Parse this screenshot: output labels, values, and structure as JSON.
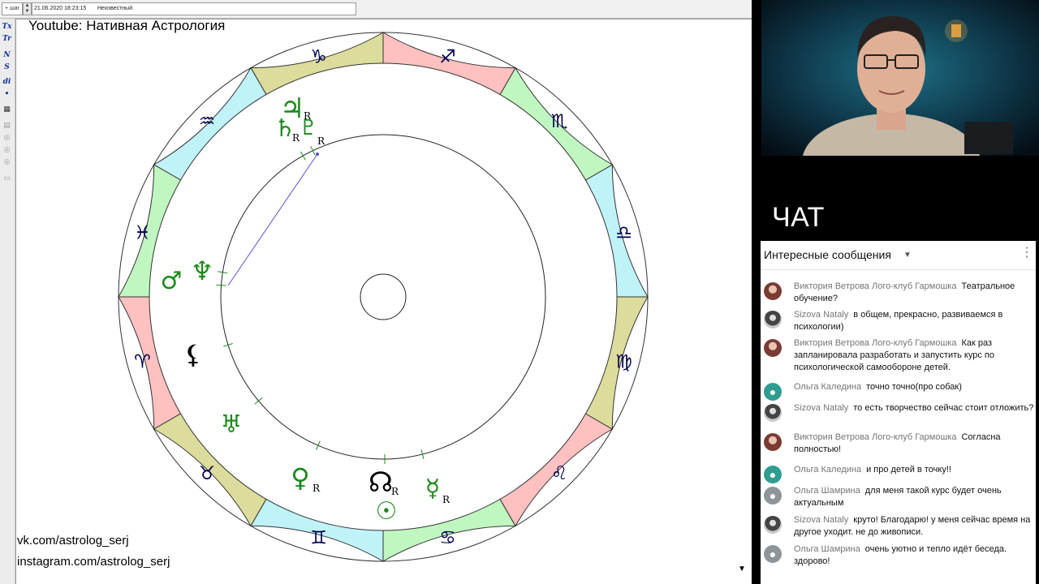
{
  "toolbar_top": {
    "step_label": "+ шаг",
    "datetime": "21.06.2020 18:23:15",
    "place": "Неизвестный"
  },
  "side_tools": [
    "Tx",
    "Tr",
    "N",
    "S",
    "di",
    "•",
    "▦",
    "▤",
    "◎",
    "◎",
    "◎",
    "▭"
  ],
  "chart_overlay": {
    "title": "Youtube: Нативная Астрология",
    "links": [
      "vk.com/astrolog_serj",
      "instagram.com/astrolog_serj"
    ]
  },
  "zodiac": {
    "colors": {
      "fire": "#ffc0c0",
      "earth": "#dcdc9c",
      "air": "#bff3f7",
      "water": "#c0f7c0"
    },
    "signs": [
      {
        "sign": "Aries",
        "glyph": "♈",
        "element": "fire"
      },
      {
        "sign": "Taurus",
        "glyph": "♉",
        "element": "earth"
      },
      {
        "sign": "Gemini",
        "glyph": "♊",
        "element": "air"
      },
      {
        "sign": "Cancer",
        "glyph": "♋",
        "element": "water"
      },
      {
        "sign": "Leo",
        "glyph": "♌",
        "element": "fire"
      },
      {
        "sign": "Virgo",
        "glyph": "♍",
        "element": "earth"
      },
      {
        "sign": "Libra",
        "glyph": "♎",
        "element": "air"
      },
      {
        "sign": "Scorpio",
        "glyph": "♏",
        "element": "water"
      },
      {
        "sign": "Sagittarius",
        "glyph": "♐",
        "element": "fire"
      },
      {
        "sign": "Capricorn",
        "glyph": "♑",
        "element": "earth"
      },
      {
        "sign": "Aquarius",
        "glyph": "♒",
        "element": "air"
      },
      {
        "sign": "Pisces",
        "glyph": "♓",
        "element": "water"
      }
    ],
    "glyph_color": "#000050"
  },
  "planets": [
    {
      "name": "jupiter",
      "glyph": "♃",
      "retro": "R",
      "color": "#1c8a1c"
    },
    {
      "name": "saturn",
      "glyph": "♄",
      "retro": "R",
      "color": "#1c8a1c"
    },
    {
      "name": "pluto",
      "glyph": "♇",
      "retro": "R",
      "color": "#1c8a1c"
    },
    {
      "name": "neptune",
      "glyph": "♆",
      "retro": "",
      "color": "#1c8a1c"
    },
    {
      "name": "mars",
      "glyph": "♂",
      "retro": "",
      "color": "#1c8a1c"
    },
    {
      "name": "lilith",
      "glyph": "⚸",
      "retro": "",
      "color": "#000000"
    },
    {
      "name": "uranus",
      "glyph": "♅",
      "retro": "",
      "color": "#1c8a1c"
    },
    {
      "name": "venus",
      "glyph": "♀",
      "retro": "R",
      "color": "#1c8a1c"
    },
    {
      "name": "node",
      "glyph": "☊",
      "retro": "R",
      "color": "#000000"
    },
    {
      "name": "sun",
      "glyph": "☉",
      "retro": "",
      "color": "#1c8a1c"
    },
    {
      "name": "mercury",
      "glyph": "☿",
      "retro": "R",
      "color": "#1c8a1c"
    }
  ],
  "chat": {
    "heading": "ЧАТ",
    "filter": "Интересные сообщения",
    "messages": [
      {
        "author": "Виктория Ветрова Лого-клуб Гармошка",
        "text": "Театральное обучение?",
        "avatar": "photo1"
      },
      {
        "author": "Sizova Nataly",
        "text": "в общем, прекрасно, развиваемся в психологии)",
        "avatar": "photo2"
      },
      {
        "author": "Виктория Ветрова Лого-клуб Гармошка",
        "text": "Как раз запланировала разработать и запустить курс по психологической самообороне детей.",
        "avatar": "photo1"
      },
      {
        "author": "Ольга Каледина",
        "text": "точно точно(про собак)",
        "avatar": "teal"
      },
      {
        "author": "Sizova Nataly",
        "text": "то есть творчество сейчас стоит отложить?",
        "avatar": "photo2"
      },
      {
        "author": "Виктория Ветрова Лого-клуб Гармошка",
        "text": "Согласна полностью!",
        "avatar": "photo1"
      },
      {
        "author": "Ольга Каледина",
        "text": "и про детей в точку!!",
        "avatar": "teal"
      },
      {
        "author": "Ольга Шамрина",
        "text": "для меня такой курс будет очень актуальным",
        "avatar": "grey"
      },
      {
        "author": "Sizova Nataly",
        "text": "круто! Благодарю! у меня сейчас время на другое уходит. не до живописи.",
        "avatar": "photo2"
      },
      {
        "author": "Ольга Шамрина",
        "text": "очень уютно и тепло идёт беседа. здорово!",
        "avatar": "grey"
      }
    ]
  }
}
